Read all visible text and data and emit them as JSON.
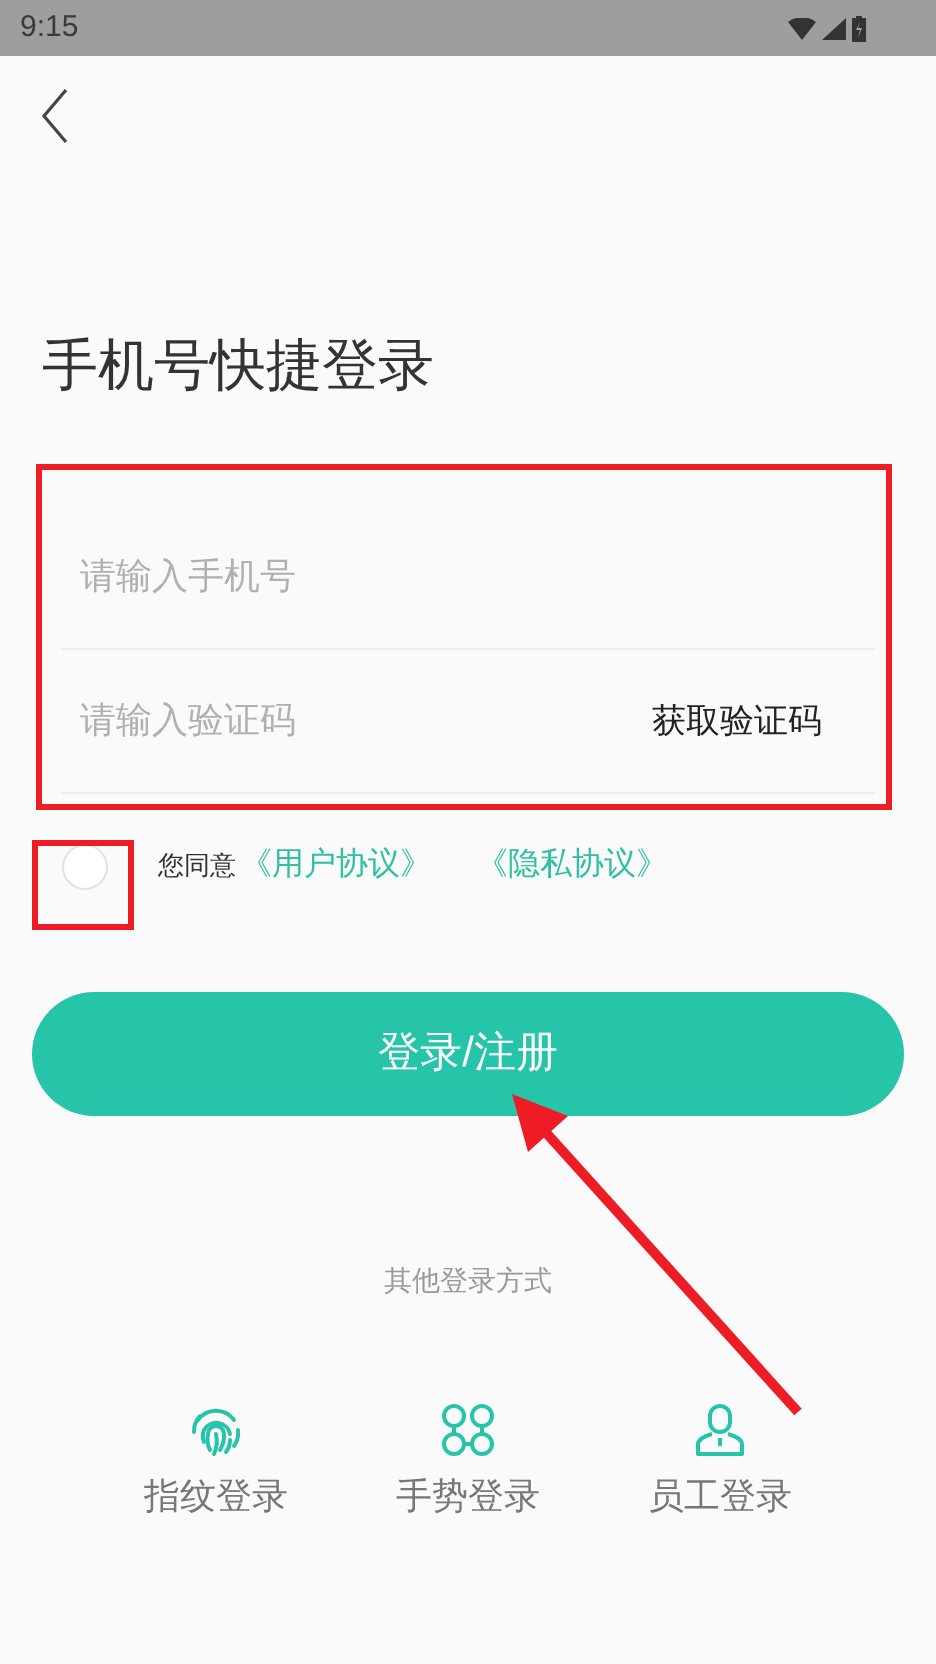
{
  "status_bar": {
    "time": "9:15"
  },
  "title": "手机号快捷登录",
  "phone_field": {
    "placeholder": "请输入手机号"
  },
  "code_field": {
    "placeholder": "请输入验证码"
  },
  "get_code_button": "获取验证码",
  "agreement": {
    "checked": false,
    "prefix": "您同意",
    "links": [
      "《用户协议》",
      "《隐私协议》"
    ]
  },
  "login_button": "登录/注册",
  "other_methods_label": "其他登录方式",
  "other_methods": [
    {
      "kind": "fingerprint",
      "label": "指纹登录"
    },
    {
      "kind": "gesture",
      "label": "手势登录"
    },
    {
      "kind": "staff",
      "label": "员工登录"
    }
  ],
  "annotations": [
    {
      "kind": "box"
    },
    {
      "kind": "box"
    },
    {
      "kind": "arrow"
    }
  ]
}
